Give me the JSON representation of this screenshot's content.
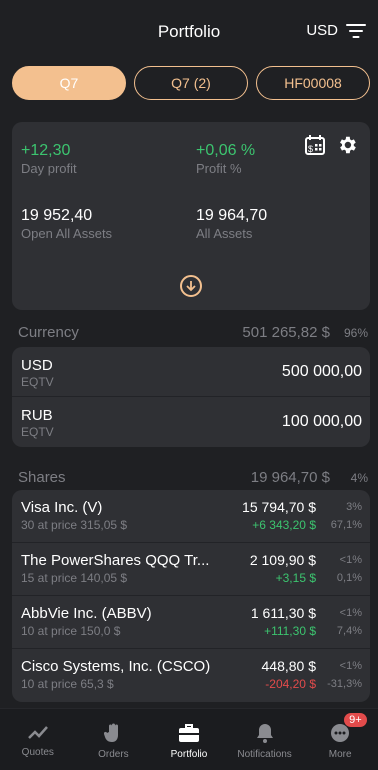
{
  "header": {
    "title": "Portfolio",
    "currency": "USD"
  },
  "tabs": [
    {
      "label": "Q7",
      "active": true
    },
    {
      "label": "Q7 (2)",
      "active": false
    },
    {
      "label": "HF00008",
      "active": false
    }
  ],
  "summary": {
    "day_profit": {
      "value": "+12,30",
      "label": "Day profit"
    },
    "profit_pct": {
      "value": "+0,06 %",
      "label": "Profit %"
    },
    "open_all_assets": {
      "value": "19 952,40",
      "label": "Open All Assets"
    },
    "all_assets": {
      "value": "19 964,70",
      "label": "All Assets"
    }
  },
  "currency_section": {
    "name": "Currency",
    "amount": "501 265,82 $",
    "pct": "96%",
    "rows": [
      {
        "code": "USD",
        "sub": "EQTV",
        "amount": "500 000,00"
      },
      {
        "code": "RUB",
        "sub": "EQTV",
        "amount": "100 000,00"
      }
    ]
  },
  "shares_section": {
    "name": "Shares",
    "amount": "19 964,70 $",
    "pct": "4%",
    "rows": [
      {
        "name": "Visa Inc. (V)",
        "detail": "30 at price 315,05 $",
        "value": "15 794,70 $",
        "change": "+6 343,20 $",
        "share": "3%",
        "change_pct": "67,1%",
        "positive": true
      },
      {
        "name": "The PowerShares QQQ Tr...",
        "detail": "15 at price 140,05 $",
        "value": "2 109,90 $",
        "change": "+3,15 $",
        "share": "<1%",
        "change_pct": "0,1%",
        "positive": true
      },
      {
        "name": "AbbVie Inc. (ABBV)",
        "detail": "10 at price 150,0 $",
        "value": "1 611,30 $",
        "change": "+111,30 $",
        "share": "<1%",
        "change_pct": "7,4%",
        "positive": true
      },
      {
        "name": "Cisco Systems, Inc. (CSCO)",
        "detail": "10 at price 65,3 $",
        "value": "448,80 $",
        "change": "-204,20 $",
        "share": "<1%",
        "change_pct": "-31,3%",
        "positive": false
      }
    ]
  },
  "tabbar": {
    "items": [
      {
        "label": "Quotes",
        "icon": "chart-line-icon"
      },
      {
        "label": "Orders",
        "icon": "hand-icon"
      },
      {
        "label": "Portfolio",
        "icon": "briefcase-icon",
        "active": true
      },
      {
        "label": "Notifications",
        "icon": "bell-icon"
      },
      {
        "label": "More",
        "icon": "more-icon",
        "badge": "9+"
      }
    ]
  },
  "colors": {
    "accent": "#f3c08f",
    "positive": "#3cc46f",
    "negative": "#e24b4b",
    "background": "#1f2023",
    "card": "#2f3034"
  }
}
